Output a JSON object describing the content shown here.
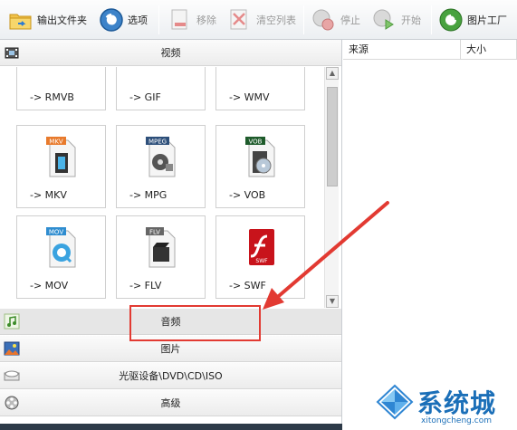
{
  "toolbar": {
    "output_folder": "输出文件夹",
    "options": "选项",
    "remove": "移除",
    "clear_list": "清空列表",
    "stop": "停止",
    "start": "开始",
    "picture_factory": "图片工厂"
  },
  "categories": {
    "video": "视频",
    "audio": "音频",
    "picture": "图片",
    "rom": "光驱设备\\DVD\\CD\\ISO",
    "advanced": "高级"
  },
  "formats_top": [
    "-> RMVB",
    "-> GIF",
    "-> WMV"
  ],
  "formats": [
    {
      "label": "-> MKV",
      "badge": "MKV"
    },
    {
      "label": "-> MPG",
      "badge": "MPEG"
    },
    {
      "label": "-> VOB",
      "badge": "VOB"
    },
    {
      "label": "-> MOV",
      "badge": "MOV"
    },
    {
      "label": "-> FLV",
      "badge": "FLV"
    },
    {
      "label": "-> SWF",
      "badge": "SWF"
    }
  ],
  "columns": {
    "source": "来源",
    "size": "大小"
  },
  "watermark": {
    "brand": "系统城",
    "url": "xitongcheng.com"
  },
  "colors": {
    "highlight": "#e23a32",
    "watermark": "#1b6fb8"
  }
}
